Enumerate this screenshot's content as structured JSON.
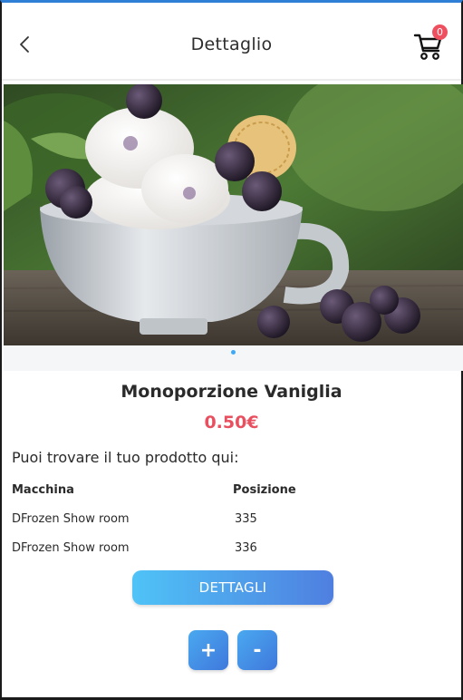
{
  "header": {
    "title": "Dettaglio",
    "back_icon": "chevron-left-icon",
    "cart_icon": "cart-icon",
    "cart_count": "0"
  },
  "carousel": {
    "image_description": "ice cream with blackberries in a white cup",
    "active_dot": 1,
    "dot_color": "#3fa9f5"
  },
  "product": {
    "name": "Monoporzione Vaniglia",
    "price": "0.50€",
    "price_color": "#e85060"
  },
  "locations": {
    "intro": "Puoi trovare il tuo prodotto qui:",
    "columns": [
      "Macchina",
      "Posizione"
    ],
    "rows": [
      {
        "machine": "DFrozen Show room",
        "position": "335"
      },
      {
        "machine": "DFrozen Show room",
        "position": "336"
      }
    ]
  },
  "actions": {
    "details_label": "DETTAGLI",
    "plus_label": "+",
    "minus_label": "-"
  },
  "colors": {
    "accent_blue": "#4f7fe0",
    "accent_cyan": "#4fc3f7",
    "badge_red": "#ef5060"
  }
}
